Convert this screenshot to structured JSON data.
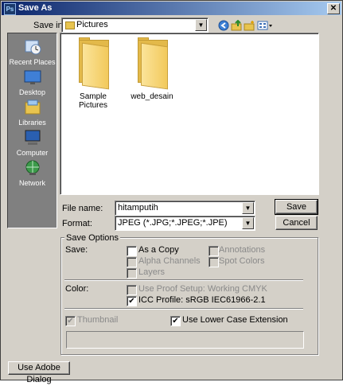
{
  "window": {
    "title": "Save As",
    "app_icon_text": "Ps"
  },
  "save_in": {
    "label": "Save in:",
    "value": "Pictures"
  },
  "toolbar": [
    "back-icon",
    "up-folder-icon",
    "new-folder-icon",
    "views-menu-icon"
  ],
  "places": [
    {
      "label": "Recent Places",
      "icon": "recent-places-icon"
    },
    {
      "label": "Desktop",
      "icon": "desktop-icon"
    },
    {
      "label": "Libraries",
      "icon": "libraries-icon"
    },
    {
      "label": "Computer",
      "icon": "computer-icon"
    },
    {
      "label": "Network",
      "icon": "network-icon"
    }
  ],
  "files": [
    {
      "name": "Sample Pictures",
      "type": "folder"
    },
    {
      "name": "web_desain",
      "type": "folder"
    }
  ],
  "file_name": {
    "label": "File name:",
    "value": "hitamputih"
  },
  "format": {
    "label": "Format:",
    "value": "JPEG (*.JPG;*.JPEG;*.JPE)"
  },
  "buttons": {
    "save": "Save",
    "cancel": "Cancel",
    "adobe_dialog": "Use Adobe Dialog"
  },
  "save_options": {
    "title": "Save Options",
    "save_label": "Save:",
    "as_copy": {
      "label": "As a Copy",
      "checked": false,
      "enabled": true
    },
    "annotations": {
      "label": "Annotations",
      "checked": false,
      "enabled": false
    },
    "alpha_channels": {
      "label": "Alpha Channels",
      "checked": false,
      "enabled": false
    },
    "spot_colors": {
      "label": "Spot Colors",
      "checked": false,
      "enabled": false
    },
    "layers": {
      "label": "Layers",
      "checked": false,
      "enabled": false
    },
    "color_label": "Color:",
    "use_proof_setup": {
      "label": "Use Proof Setup:  Working CMYK",
      "checked": false,
      "enabled": false
    },
    "icc_profile": {
      "label": "ICC Profile:  sRGB IEC61966-2.1",
      "checked": true,
      "enabled": true
    },
    "thumbnail": {
      "label": "Thumbnail",
      "checked": true,
      "enabled": false
    },
    "lower_case_ext": {
      "label": "Use Lower Case Extension",
      "checked": true,
      "enabled": true
    }
  }
}
